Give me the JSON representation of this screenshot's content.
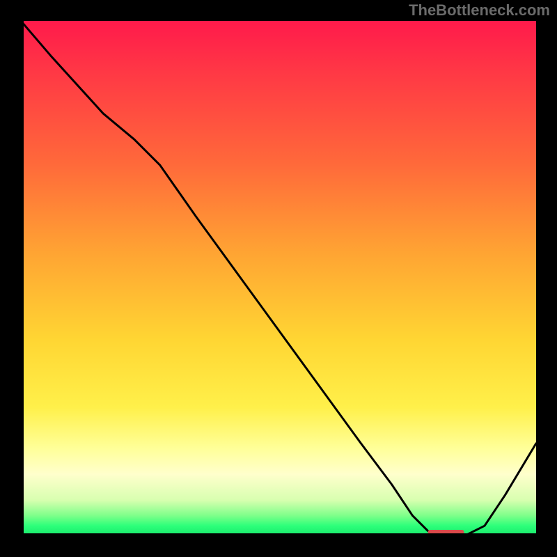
{
  "attribution": "TheBottleneck.com",
  "chart_data": {
    "type": "line",
    "title": "",
    "xlabel": "",
    "ylabel": "",
    "xrange": [
      0,
      100
    ],
    "yrange": [
      0,
      100
    ],
    "series": [
      {
        "name": "curve",
        "x": [
          0,
          6,
          16,
          22,
          27,
          34,
          42,
          50,
          58,
          66,
          72,
          76,
          79,
          82,
          86,
          90,
          94,
          100
        ],
        "y": [
          100,
          93,
          82,
          77,
          72,
          62,
          51,
          40,
          29,
          18,
          10,
          4,
          1,
          0,
          0,
          2,
          8,
          18
        ]
      }
    ],
    "flat_segment": {
      "x_start": 79,
      "x_end": 86,
      "y": 0
    },
    "background_gradient_top": "#ff1a4b",
    "background_gradient_bottom": "#16e86b"
  }
}
